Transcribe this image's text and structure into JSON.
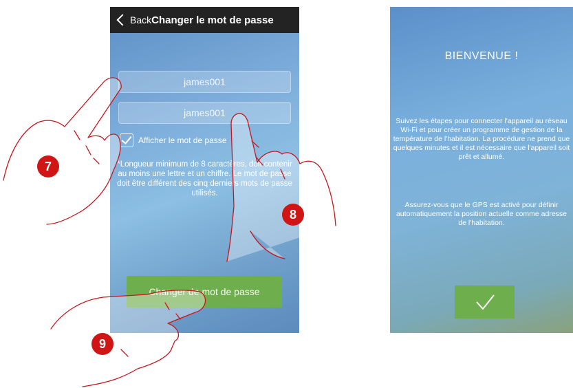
{
  "phone1": {
    "topbar": {
      "back_label": "Back",
      "title": "Changer le mot de passe"
    },
    "password_field_1": {
      "value": "james001"
    },
    "password_field_2": {
      "value": "james001"
    },
    "show_password_label": "Afficher le mot de passe",
    "hint": "*Longueur minimum de 8 caractères, doit contenir au moins une lettre et un chiffre. Le mot de passe doit être différent des cinq derniers mots de passe utilisés.",
    "action_button": "Changer de mot de passe"
  },
  "phone2": {
    "title": "BIENVENUE !",
    "text1": "Suivez les étapes pour connecter l'appareil au réseau Wi-Fi et pour créer un programme de gestion de la température de l'habitation. La procédure ne prend que quelques minutes et il est nécessaire que l'appareil soit prêt et allumé.",
    "text2": "Assurez-vous que le GPS est activé pour définir automatiquement la position actuelle comme adresse de l'habitation.",
    "confirm_icon": "checkmark-icon"
  },
  "markers": {
    "m7": "7",
    "m8": "8",
    "m9": "9"
  },
  "colors": {
    "accent_green": "#6fae4d",
    "marker_red": "#d01515",
    "topbar": "#232323"
  }
}
